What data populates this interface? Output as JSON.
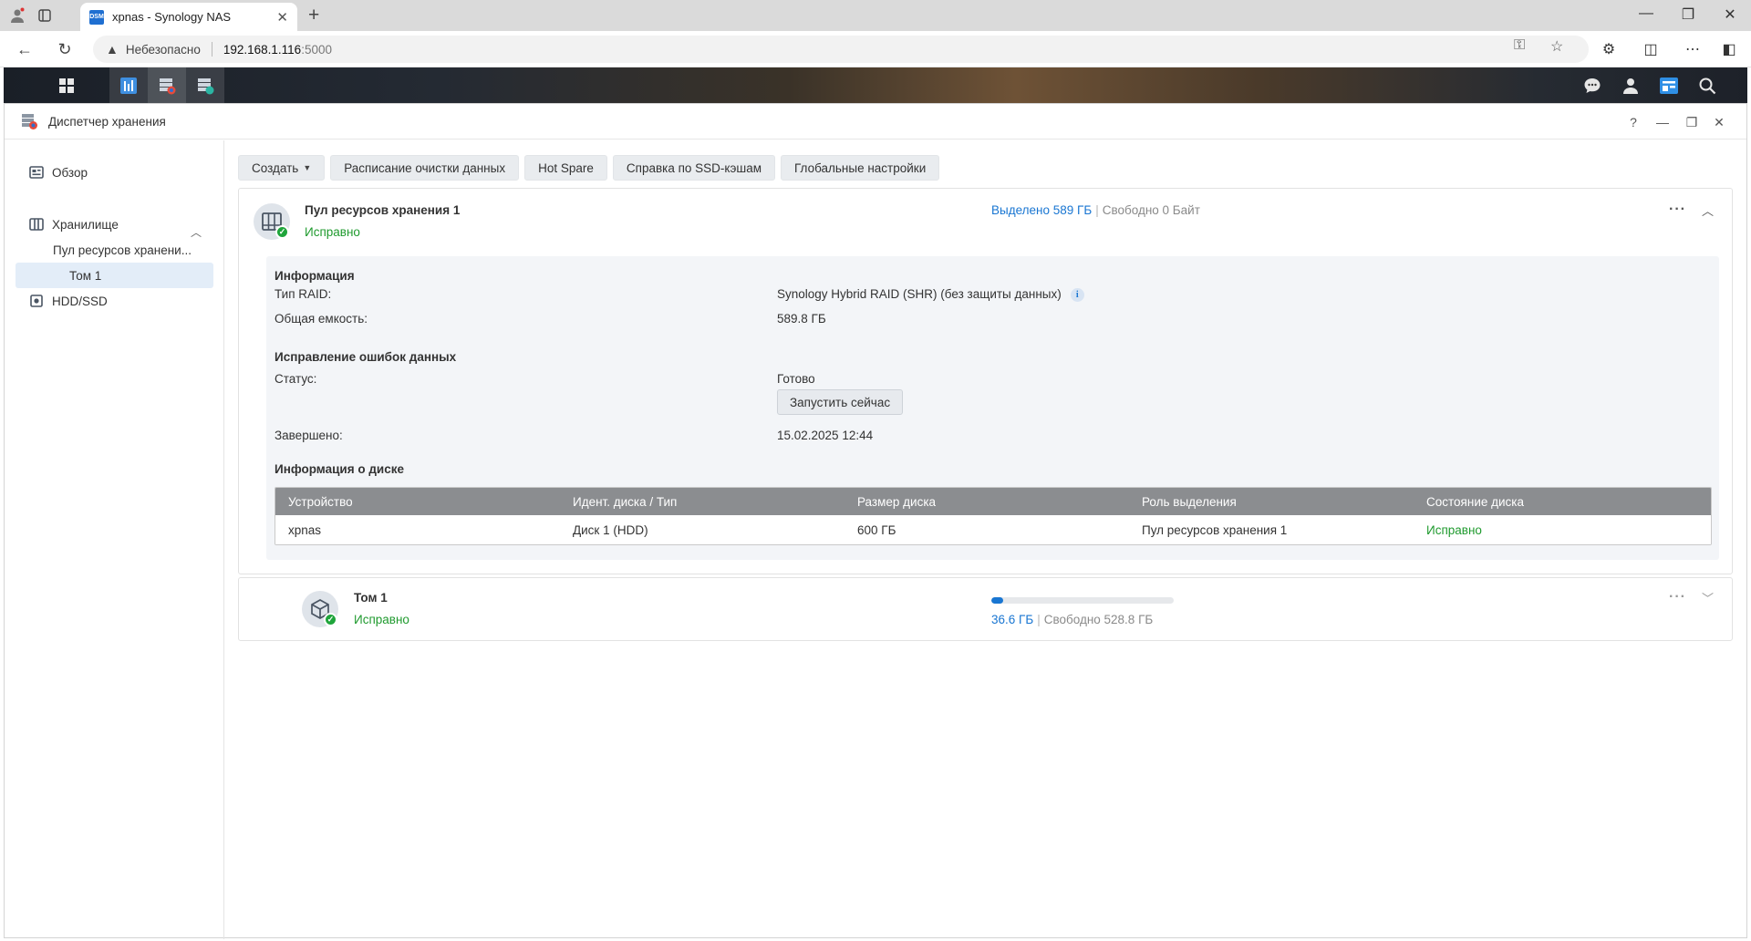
{
  "browser": {
    "tab_title": "xpnas - Synology NAS",
    "favicon_text": "DSM",
    "insecure_label": "Небезопасно",
    "url_host": "192.168.1.116",
    "url_port": ":5000"
  },
  "window": {
    "title": "Диспетчер хранения",
    "help_label": "?"
  },
  "sidebar": {
    "items": [
      {
        "label": "Обзор",
        "icon": "overview-icon"
      },
      {
        "label": "Хранилище",
        "icon": "storage-icon"
      },
      {
        "label": "HDD/SSD",
        "icon": "hdd-icon"
      }
    ],
    "sub_pool": "Пул ресурсов хранени...",
    "sub_volume": "Том 1"
  },
  "toolbar": {
    "create_label": "Создать",
    "scrub_schedule_label": "Расписание очистки данных",
    "hot_spare_label": "Hot Spare",
    "ssd_cache_label": "Справка по SSD-кэшам",
    "global_settings_label": "Глобальные настройки"
  },
  "pool": {
    "name": "Пул ресурсов хранения 1",
    "status": "Исправно",
    "allocated": "Выделено 589 ГБ",
    "separator": "|",
    "free": "Свободно 0 Байт",
    "info": {
      "section_title": "Информация",
      "raid_label": "Тип RAID:",
      "raid_value": "Synology Hybrid RAID (SHR) (без защиты данных)",
      "capacity_label": "Общая емкость:",
      "capacity_value": "589.8 ГБ"
    },
    "scrub": {
      "section_title": "Исправление ошибок данных",
      "status_label": "Статус:",
      "status_value": "Готово",
      "run_now_label": "Запустить сейчас",
      "finished_label": "Завершено:",
      "finished_value": "15.02.2025 12:44"
    },
    "disks": {
      "section_title": "Информация о диске",
      "columns": [
        "Устройство",
        "Идент. диска / Тип",
        "Размер диска",
        "Роль выделения",
        "Состояние диска"
      ],
      "rows": [
        [
          "xpnas",
          "Диск 1 (HDD)",
          "600 ГБ",
          "Пул ресурсов хранения 1",
          "Исправно"
        ]
      ]
    }
  },
  "volume": {
    "name": "Том 1",
    "status": "Исправно",
    "used": "36.6 ГБ",
    "separator": "|",
    "free": "Свободно 528.8 ГБ",
    "usage_fraction": 0.065
  },
  "colors": {
    "accent": "#1976d2",
    "ok": "#1f9a2e"
  }
}
